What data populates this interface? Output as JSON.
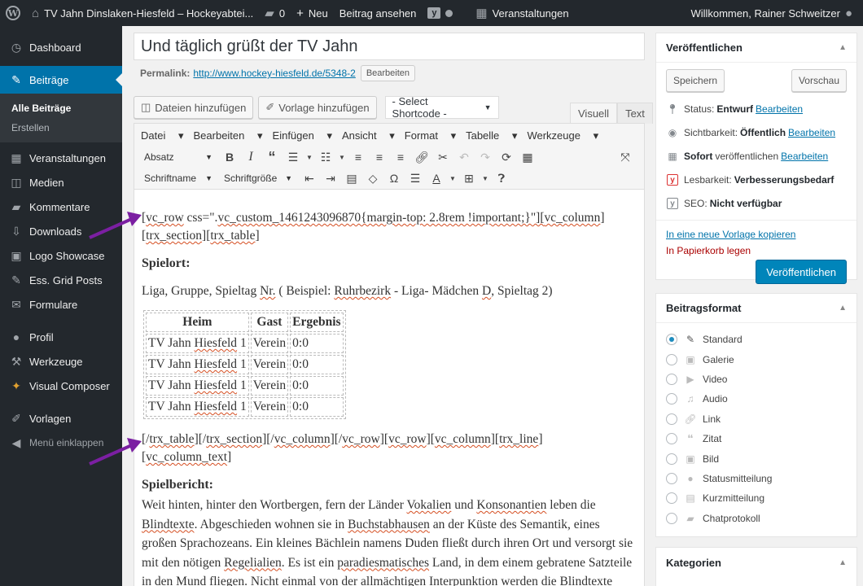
{
  "adminbar": {
    "site_name": "TV Jahn Dinslaken-Hiesfeld – Hockeyabtei...",
    "comments_count": "0",
    "new_label": "Neu",
    "view_post": "Beitrag ansehen",
    "events": "Veranstaltungen",
    "welcome": "Willkommen, Rainer Schweitzer"
  },
  "sidebar": {
    "dashboard": "Dashboard",
    "posts": "Beiträge",
    "all_posts": "Alle Beiträge",
    "create": "Erstellen",
    "events": "Veranstaltungen",
    "media": "Medien",
    "comments": "Kommentare",
    "downloads": "Downloads",
    "logo_showcase": "Logo Showcase",
    "grid_posts": "Ess. Grid Posts",
    "forms": "Formulare",
    "profile": "Profil",
    "tools": "Werkzeuge",
    "visual_composer": "Visual Composer",
    "templates": "Vorlagen",
    "collapse": "Menü einklappen"
  },
  "editor": {
    "title": "Und täglich grüßt der TV Jahn",
    "permalink_label": "Permalink:",
    "permalink_url": "http://www.hockey-hiesfeld.de/5348-2",
    "edit": "Bearbeiten",
    "add_media": "Dateien hinzufügen",
    "add_template": "Vorlage hinzufügen",
    "shortcode_select": "- Select Shortcode -",
    "tab_visual": "Visuell",
    "tab_text": "Text",
    "menu": [
      "Datei",
      "Bearbeiten",
      "Einfügen",
      "Ansicht",
      "Format",
      "Tabelle",
      "Werkzeuge"
    ],
    "paragraph_select": "Absatz",
    "font_select": "Schriftname",
    "size_select": "Schriftgröße"
  },
  "content": {
    "sc1_a": "vc_row",
    "sc1_b": " css=\".",
    "sc1_c": "vc_custom_1461243096870{margin-top: 2.8rem !important;}\"][",
    "sc1_d": "vc_column",
    "sc1_e": "]",
    "sc1_f": "trx_section",
    "sc1_g": "][",
    "sc1_h": "trx_table",
    "sc1_i": "]",
    "spielort": "Spielort:",
    "liga_text_1": "Liga, Gruppe, Spieltag ",
    "liga_nr": "Nr.",
    "liga_text_2": " ( Beispiel: ",
    "liga_ruhr": "Ruhrbezirk",
    "liga_text_3": " - Liga- Mädchen ",
    "liga_d": "D",
    "liga_text_4": ", Spieltag 2)",
    "table_headers": [
      "Heim",
      "Gast",
      "Ergebnis"
    ],
    "table_rows": [
      {
        "heim_a": "TV Jahn ",
        "heim_b": "Hiesfeld",
        "heim_c": " 1",
        "gast": "Verein",
        "ergebnis": "0:0"
      },
      {
        "heim_a": "TV Jahn ",
        "heim_b": "Hiesfeld",
        "heim_c": " 1",
        "gast": "Verein",
        "ergebnis": "0:0"
      },
      {
        "heim_a": "TV Jahn ",
        "heim_b": "Hiesfeld",
        "heim_c": " 1",
        "gast": "Verein",
        "ergebnis": "0:0"
      },
      {
        "heim_a": "TV Jahn ",
        "heim_b": "Hiesfeld",
        "heim_c": " 1",
        "gast": "Verein",
        "ergebnis": "0:0"
      }
    ],
    "sc2_a": "[/",
    "sc2_b": "trx_table",
    "sc2_c": "][/",
    "sc2_d": "trx_section",
    "sc2_e": "][/",
    "sc2_f": "vc_column",
    "sc2_g": "][/",
    "sc2_h": "vc_row",
    "sc2_i": "][",
    "sc2_j": "vc_row",
    "sc2_k": "][",
    "sc2_l": "vc_column",
    "sc2_m": "][",
    "sc2_n": "trx_line",
    "sc2_o": "]",
    "sc2_p": "vc_column_text",
    "sc2_q": "]",
    "spielbericht": "Spielbericht:",
    "p1": "Weit hinten, hinter den Wortbergen, fern der Länder ",
    "w_vokalien": "Vokalien",
    "p2": " und ",
    "w_konsonantien": "Konsonantien",
    "p3": " leben die ",
    "w_blindtexte": "Blindtexte",
    "p4": ". Abgeschieden wohnen sie in ",
    "w_buchstabhausen": "Buchstabhausen",
    "p5": " an der Küste des Semantik, eines großen Sprachozeans. Ein kleines Bächlein namens Duden fließt durch ihren Ort und versorgt sie mit den nötigen ",
    "w_regelialien": "Regelialien",
    "p6": ". Es ist ein ",
    "w_paradiesmatisches": "paradiesmatisches",
    "p7": " Land, in dem einem gebratene Satzteile in den Mund fliegen. Nicht einmal von der allmächtigen Interpunktion werden die ",
    "w_blindtexte2": "Blindtexte"
  },
  "publish": {
    "title": "Veröffentlichen",
    "save": "Speichern",
    "preview": "Vorschau",
    "status_label": "Status:",
    "status_value": "Entwurf",
    "visibility_label": "Sichtbarkeit:",
    "visibility_value": "Öffentlich",
    "schedule_bold": "Sofort",
    "schedule_text": "veröffentlichen",
    "readability_label": "Lesbarkeit:",
    "readability_value": "Verbesserungsbedarf",
    "seo_label": "SEO:",
    "seo_value": "Nicht verfügbar",
    "edit": "Bearbeiten",
    "copy_template": "In eine neue Vorlage kopieren",
    "trash": "In Papierkorb legen",
    "publish_btn": "Veröffentlichen"
  },
  "format": {
    "title": "Beitragsformat",
    "options": [
      "Standard",
      "Galerie",
      "Video",
      "Audio",
      "Link",
      "Zitat",
      "Bild",
      "Statusmitteilung",
      "Kurzmitteilung",
      "Chatprotokoll"
    ]
  },
  "categories": {
    "title": "Kategorien"
  },
  "colors": {
    "accent": "#0073aa",
    "sidebar_bg": "#23282d",
    "arrow": "#7b1fa2",
    "primary_btn": "#0085ba"
  }
}
